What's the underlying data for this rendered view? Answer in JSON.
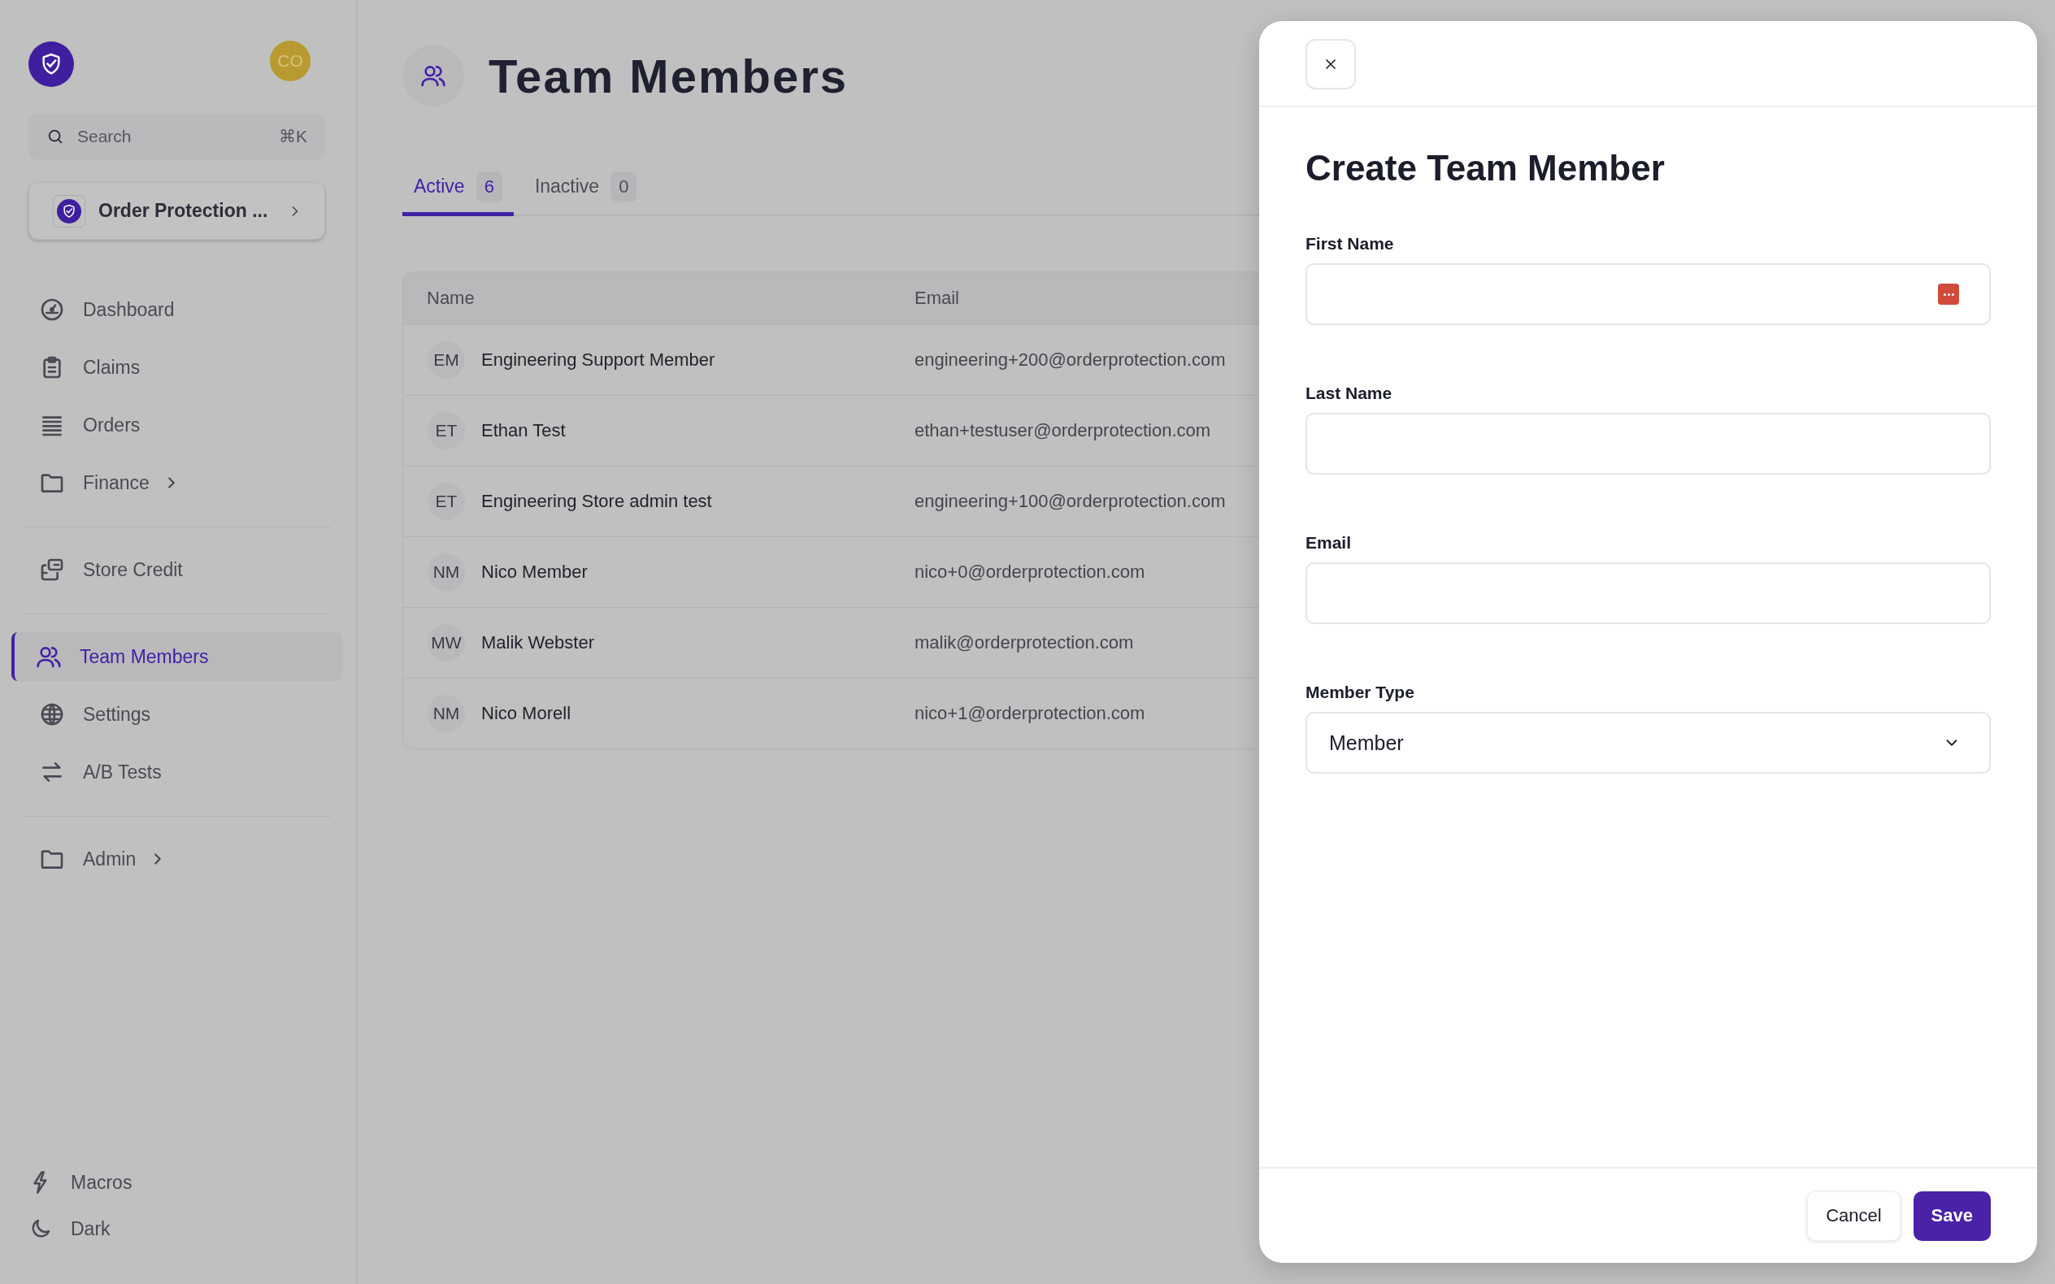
{
  "sidebar": {
    "avatar": "CO",
    "search": {
      "placeholder": "Search",
      "shortcut": "⌘K"
    },
    "org": {
      "name": "Order Protection ..."
    },
    "nav_groups": [
      [
        {
          "label": "Dashboard",
          "selected": false,
          "expandable": false
        },
        {
          "label": "Claims",
          "selected": false,
          "expandable": false
        },
        {
          "label": "Orders",
          "selected": false,
          "expandable": false
        },
        {
          "label": "Finance",
          "selected": false,
          "expandable": true
        }
      ],
      [
        {
          "label": "Store Credit",
          "selected": false,
          "expandable": false
        }
      ],
      [
        {
          "label": "Team Members",
          "selected": true,
          "expandable": false
        },
        {
          "label": "Settings",
          "selected": false,
          "expandable": false
        },
        {
          "label": "A/B Tests",
          "selected": false,
          "expandable": false
        }
      ],
      [
        {
          "label": "Admin",
          "selected": false,
          "expandable": true
        }
      ]
    ],
    "footer": [
      {
        "label": "Macros"
      },
      {
        "label": "Dark"
      }
    ]
  },
  "page": {
    "title": "Team Members",
    "tabs": [
      {
        "label": "Active",
        "count": "6",
        "selected": true
      },
      {
        "label": "Inactive",
        "count": "0",
        "selected": false
      }
    ],
    "table": {
      "columns": [
        "Name",
        "Email"
      ],
      "rows": [
        {
          "initials": "EM",
          "name": "Engineering Support Member",
          "email": "engineering+200@orderprotection.com"
        },
        {
          "initials": "ET",
          "name": "Ethan Test",
          "email": "ethan+testuser@orderprotection.com"
        },
        {
          "initials": "ET",
          "name": "Engineering Store admin test",
          "email": "engineering+100@orderprotection.com"
        },
        {
          "initials": "NM",
          "name": "Nico Member",
          "email": "nico+0@orderprotection.com"
        },
        {
          "initials": "MW",
          "name": "Malik Webster",
          "email": "malik@orderprotection.com"
        },
        {
          "initials": "NM",
          "name": "Nico Morell",
          "email": "nico+1@orderprotection.com"
        }
      ]
    }
  },
  "modal": {
    "title": "Create Team Member",
    "fields": [
      {
        "label": "First Name",
        "kind": "text",
        "autofill": true
      },
      {
        "label": "Last Name",
        "kind": "text",
        "autofill": false
      },
      {
        "label": "Email",
        "kind": "text",
        "autofill": false
      },
      {
        "label": "Member Type",
        "kind": "select",
        "value": "Member"
      }
    ],
    "buttons": [
      {
        "label": "Cancel",
        "kind": "secondary"
      },
      {
        "label": "Save",
        "kind": "primary"
      }
    ]
  }
}
